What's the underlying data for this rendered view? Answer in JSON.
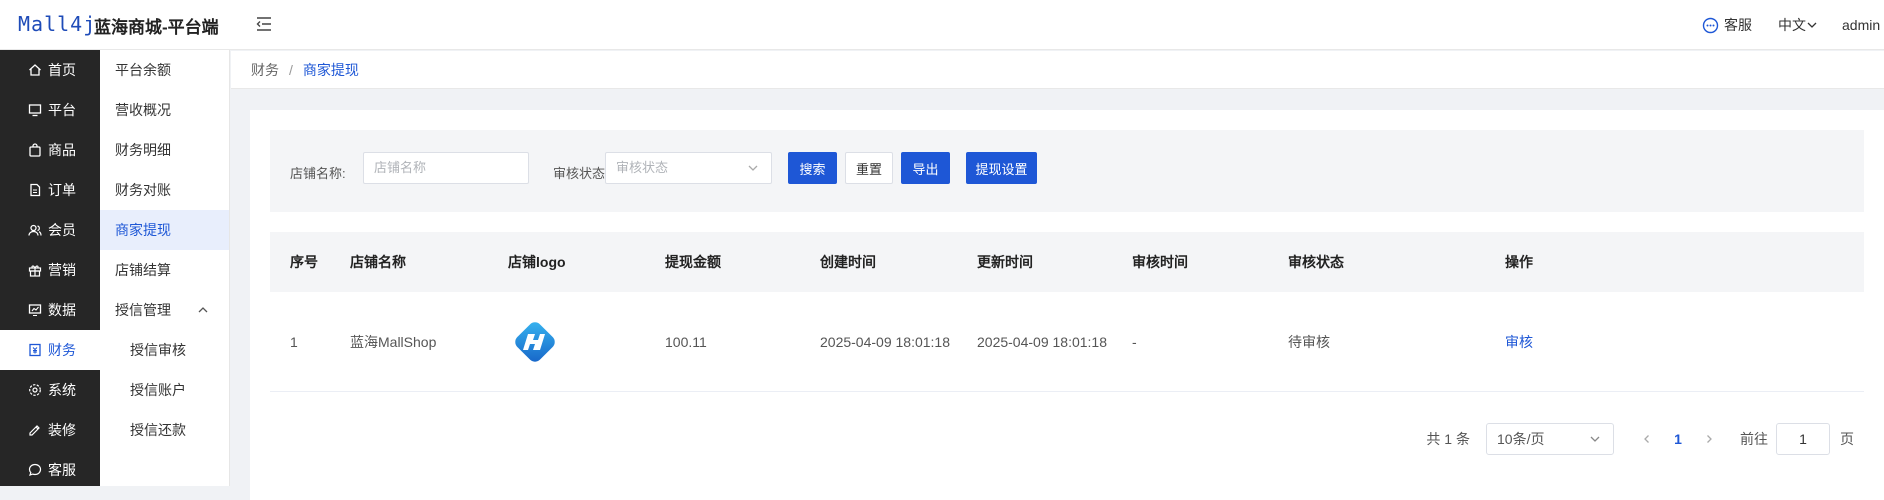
{
  "header": {
    "logo": "Mall4j",
    "title": "蓝海商城-平台端",
    "service": "客服",
    "language": "中文",
    "user": "admin"
  },
  "sidebar": {
    "items": [
      {
        "label": "首页",
        "icon": "home-icon"
      },
      {
        "label": "平台",
        "icon": "monitor-icon"
      },
      {
        "label": "商品",
        "icon": "bag-icon"
      },
      {
        "label": "订单",
        "icon": "document-icon"
      },
      {
        "label": "会员",
        "icon": "users-icon"
      },
      {
        "label": "营销",
        "icon": "gift-icon"
      },
      {
        "label": "数据",
        "icon": "chart-icon"
      },
      {
        "label": "财务",
        "icon": "finance-icon",
        "active": true
      },
      {
        "label": "系统",
        "icon": "gear-icon"
      },
      {
        "label": "装修",
        "icon": "brush-icon"
      },
      {
        "label": "客服",
        "icon": "chat-icon"
      }
    ]
  },
  "submenu": {
    "items": [
      {
        "label": "平台余额"
      },
      {
        "label": "营收概况"
      },
      {
        "label": "财务明细"
      },
      {
        "label": "财务对账"
      },
      {
        "label": "商家提现",
        "active": true
      },
      {
        "label": "店铺结算"
      },
      {
        "label": "授信管理",
        "expandable": true
      },
      {
        "label": "授信审核",
        "sub": true
      },
      {
        "label": "授信账户",
        "sub": true
      },
      {
        "label": "授信还款",
        "sub": true
      }
    ]
  },
  "breadcrumb": {
    "parent": "财务",
    "separator": "/",
    "current": "商家提现"
  },
  "filter": {
    "shop_label": "店铺名称:",
    "shop_placeholder": "店铺名称",
    "status_label": "审核状态:",
    "status_placeholder": "审核状态",
    "search": "搜索",
    "reset": "重置",
    "export": "导出",
    "settings": "提现设置"
  },
  "table": {
    "columns": [
      "序号",
      "店铺名称",
      "店铺logo",
      "提现金额",
      "创建时间",
      "更新时间",
      "审核时间",
      "审核状态",
      "操作"
    ],
    "rows": [
      {
        "index": "1",
        "shop": "蓝海MallShop",
        "amount": "100.11",
        "created": "2025-04-09 18:01:18",
        "updated": "2025-04-09 18:01:18",
        "audited": "-",
        "status": "待审核",
        "action": "审核"
      }
    ]
  },
  "pagination": {
    "total": "共 1 条",
    "page_size": "10条/页",
    "current_page": "1",
    "goto_label": "前往",
    "goto_value": "1",
    "page_suffix": "页"
  },
  "colors": {
    "primary": "#1e57d6",
    "sidebar_bg": "#262626"
  }
}
